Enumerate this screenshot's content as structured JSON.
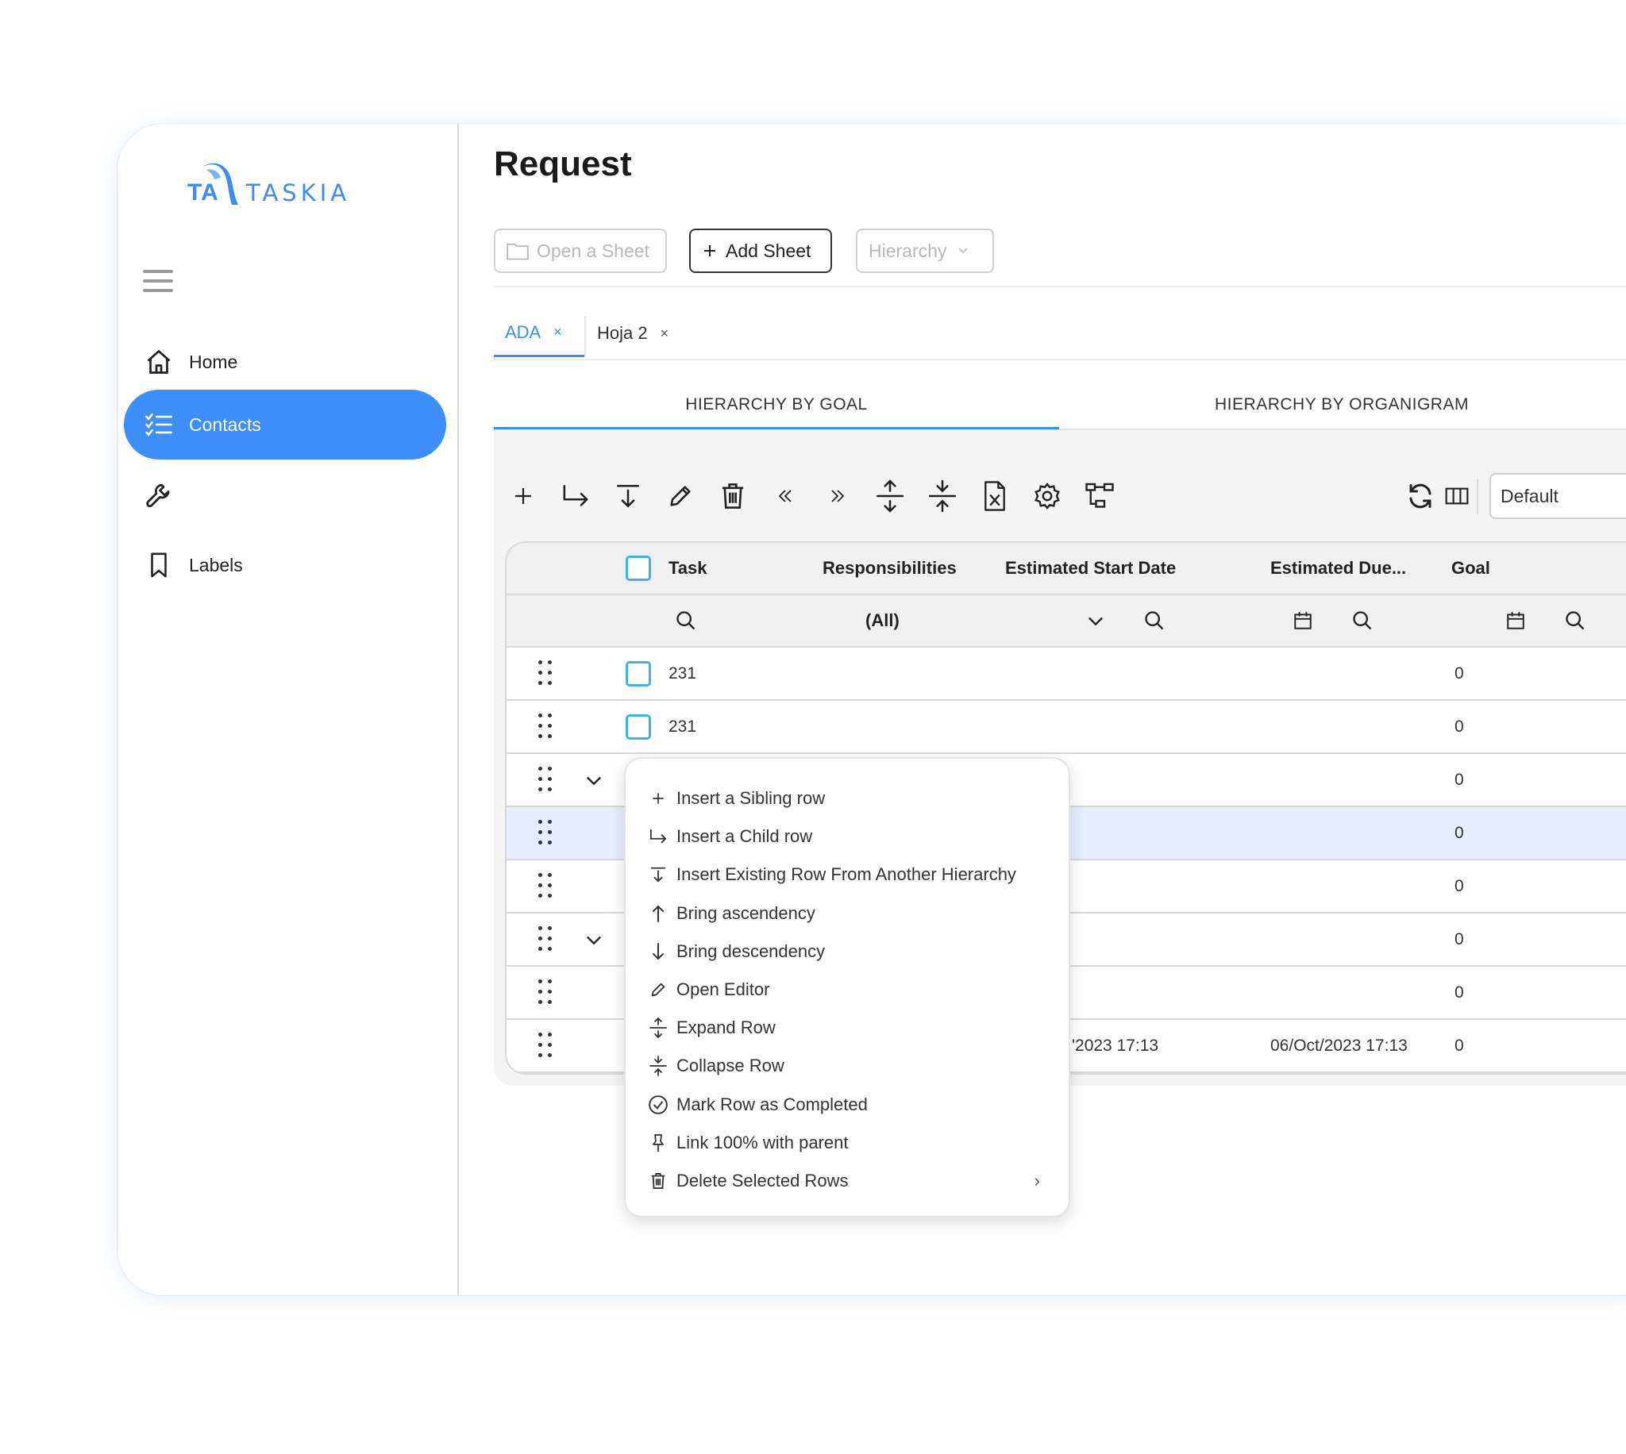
{
  "brand": {
    "name": "TASKIA",
    "mark_text": "TA",
    "color": "#3b8df0"
  },
  "sidebar": {
    "items": [
      {
        "label": "Home",
        "icon": "home-icon"
      },
      {
        "label": "Contacts",
        "icon": "checklist-icon",
        "active": true
      },
      {
        "label": "",
        "icon": "wrench-icon"
      },
      {
        "label": "Labels",
        "icon": "bookmark-icon"
      }
    ]
  },
  "page": {
    "title": "Request"
  },
  "actions": {
    "open_sheet": "Open a Sheet",
    "add_sheet": "Add Sheet",
    "hierarchy": "Hierarchy"
  },
  "sheet_tabs": [
    {
      "label": "ADA",
      "close": "×",
      "active": true
    },
    {
      "label": "Hoja 2",
      "close": "×",
      "active": false
    }
  ],
  "view_tabs": [
    {
      "label": "HIERARCHY BY GOAL",
      "active": true
    },
    {
      "label": "HIERARCHY BY ORGANIGRAM",
      "active": false
    }
  ],
  "toolbar": {
    "buttons": [
      "plus-icon",
      "child-arrow-icon",
      "insert-existing-icon",
      "pencil-icon",
      "trash-icon",
      "double-chevron-left-icon",
      "double-chevron-right-icon",
      "expand-icon",
      "collapse-icon",
      "excel-icon",
      "gear-icon",
      "hierarchy-icon",
      "refresh-icon",
      "columns-icon"
    ],
    "view_select": "Default"
  },
  "grid": {
    "columns": [
      "Task",
      "Responsibilities",
      "Estimated Start Date",
      "Estimated Due...",
      "Goal"
    ],
    "filter": {
      "responsibilities": "(All)"
    },
    "rows": [
      {
        "task": "231",
        "start": "",
        "due": "",
        "goal": "0",
        "checkbox": true,
        "expand": false
      },
      {
        "task": "231",
        "start": "",
        "due": "",
        "goal": "0",
        "checkbox": true,
        "expand": false
      },
      {
        "task": "",
        "start": "",
        "due": "",
        "goal": "0",
        "checkbox": false,
        "expand": true
      },
      {
        "task": "",
        "start": "",
        "due": "",
        "goal": "0",
        "checkbox": false,
        "expand": false,
        "selected": true
      },
      {
        "task": "",
        "start": "",
        "due": "",
        "goal": "0",
        "checkbox": false,
        "expand": false
      },
      {
        "task": "",
        "start": "",
        "due": "",
        "goal": "0",
        "checkbox": false,
        "expand": true
      },
      {
        "task": "",
        "start": "",
        "due": "",
        "goal": "0",
        "checkbox": false,
        "expand": false
      },
      {
        "task": "",
        "start": "'2023 17:13",
        "due": "06/Oct/2023 17:13",
        "goal": "0",
        "checkbox": false,
        "expand": false
      }
    ]
  },
  "context_menu": {
    "items": [
      {
        "label": "Insert a Sibling row",
        "icon": "plus-icon"
      },
      {
        "label": "Insert a Child row",
        "icon": "child-arrow-icon"
      },
      {
        "label": "Insert Existing Row From Another Hierarchy",
        "icon": "insert-existing-icon"
      },
      {
        "label": "Bring ascendency",
        "icon": "arrow-up-icon"
      },
      {
        "label": "Bring descendency",
        "icon": "arrow-down-icon"
      },
      {
        "label": "Open Editor",
        "icon": "pencil-icon"
      },
      {
        "label": "Expand Row",
        "icon": "expand-icon"
      },
      {
        "label": "Collapse Row",
        "icon": "collapse-icon"
      },
      {
        "label": "Mark Row as Completed",
        "icon": "check-circle-icon"
      },
      {
        "label": "Link 100% with parent",
        "icon": "pin-icon"
      },
      {
        "label": "Delete Selected Rows",
        "icon": "trash-icon",
        "submenu": "›"
      }
    ]
  }
}
